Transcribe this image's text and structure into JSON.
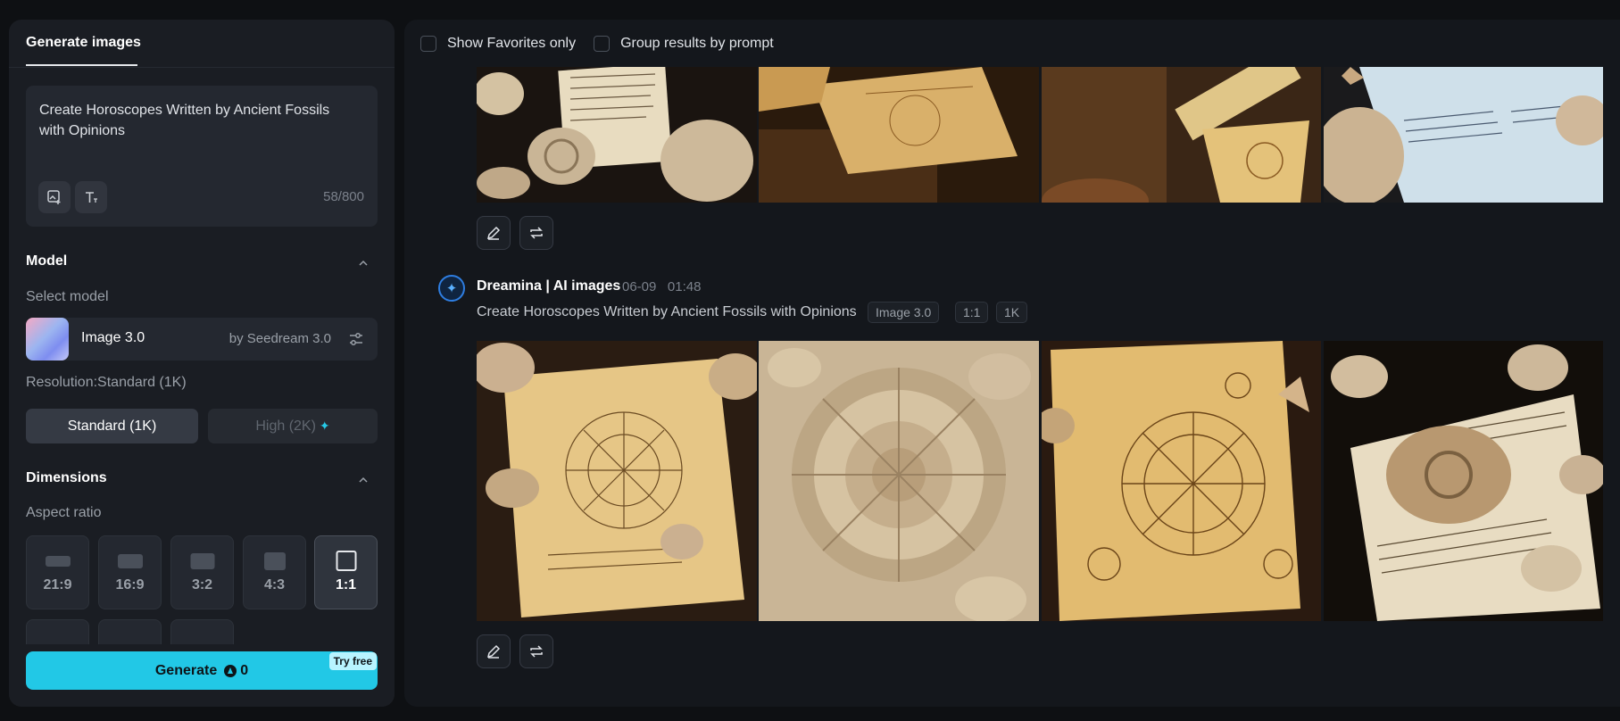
{
  "left_panel": {
    "tab_label": "Generate images",
    "prompt": {
      "text": "Create Horoscopes Written by Ancient Fossils with Opinions",
      "char_count": "58/800",
      "tools": [
        "image-reference-icon",
        "text-style-icon"
      ]
    },
    "model_section": {
      "title": "Model",
      "select_label": "Select model",
      "model_name": "Image 3.0",
      "model_by": "by Seedream 3.0",
      "resolution_label": "Resolution:Standard (1K)",
      "resolution_options": [
        "Standard (1K)",
        "High (2K)"
      ],
      "selected_resolution": "Standard (1K)"
    },
    "dimensions_section": {
      "title": "Dimensions",
      "aspect_label": "Aspect ratio",
      "ratios": [
        "21:9",
        "16:9",
        "3:2",
        "4:3",
        "1:1"
      ],
      "selected_ratio": "1:1"
    },
    "generate": {
      "label": "Generate",
      "cost": "0",
      "badge": "Try free"
    }
  },
  "results": {
    "filters": {
      "favorites_label": "Show Favorites only",
      "group_label": "Group results by prompt"
    },
    "generation": {
      "author": "Dreamina | AI images",
      "date": "06-09",
      "time": "01:48",
      "prompt": "Create Horoscopes Written by Ancient Fossils with Opinions",
      "tags": [
        "Image 3.0",
        "1:1",
        "1K"
      ]
    },
    "image_count_per_row": 4
  },
  "colors": {
    "accent": "#22c8e6",
    "panel_bg": "#1a1d23",
    "page_bg": "#0e1013"
  }
}
